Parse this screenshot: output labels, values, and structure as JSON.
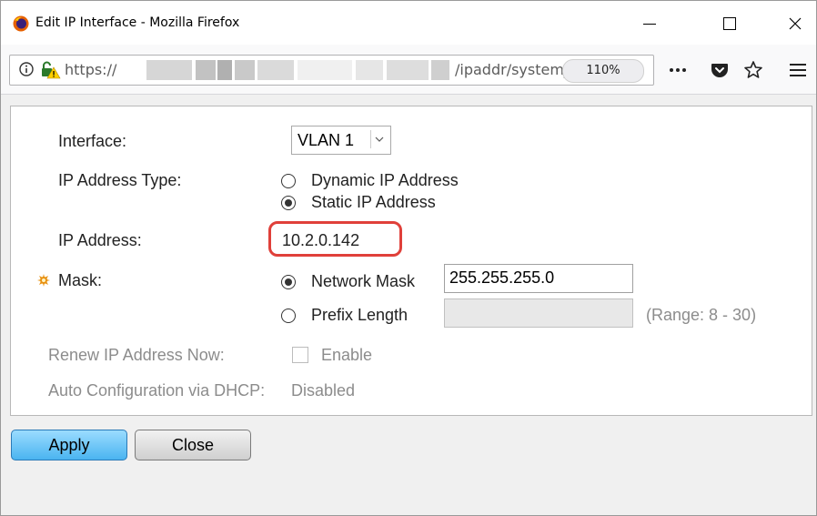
{
  "window": {
    "title": "Edit IP Interface - Mozilla Firefox"
  },
  "navbar": {
    "url_prefix": "https://",
    "url_suffix": "/ipaddr/system_",
    "zoom": "110%"
  },
  "form": {
    "interface_label": "Interface:",
    "interface_value": "VLAN 1",
    "ip_type_label": "IP Address Type:",
    "ip_type_options": [
      "Dynamic IP Address",
      "Static IP Address"
    ],
    "ip_type_selected": "Static IP Address",
    "ip_address_label": "IP Address:",
    "ip_address_value": "10.2.0.142",
    "mask_label": "Mask:",
    "mask_options": [
      "Network Mask",
      "Prefix Length"
    ],
    "mask_selected": "Network Mask",
    "network_mask_value": "255.255.255.0",
    "prefix_length_value": "",
    "prefix_range": "(Range: 8 - 30)",
    "renew_label": "Renew IP Address Now:",
    "renew_checkbox_label": "Enable",
    "renew_checked": false,
    "auto_config_label": "Auto Configuration via DHCP:",
    "auto_config_value": "Disabled"
  },
  "buttons": {
    "apply": "Apply",
    "close": "Close"
  },
  "colors": {
    "highlight": "#e0403a",
    "apply_button": "#4ab4f0"
  }
}
